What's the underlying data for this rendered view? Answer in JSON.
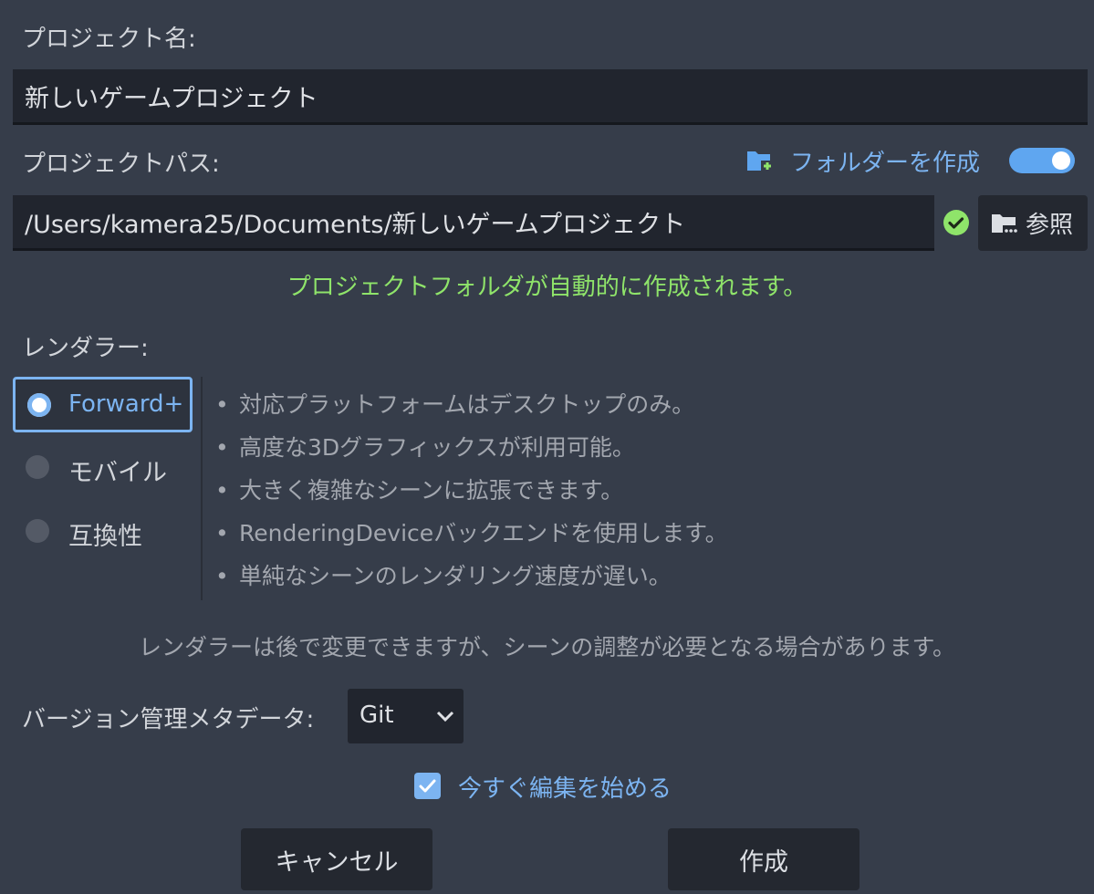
{
  "project_name": {
    "label": "プロジェクト名:",
    "value": "新しいゲームプロジェクト"
  },
  "project_path": {
    "label": "プロジェクトパス:",
    "create_folder_label": "フォルダーを作成",
    "create_folder_enabled": true,
    "value": "/Users/kamera25/Documents/新しいゲームプロジェクト",
    "browse_label": "参照",
    "status_message": "プロジェクトフォルダが自動的に作成されます。"
  },
  "renderer": {
    "label": "レンダラー:",
    "options": [
      {
        "label": "Forward+",
        "selected": true
      },
      {
        "label": "モバイル",
        "selected": false
      },
      {
        "label": "互換性",
        "selected": false
      }
    ],
    "bullet_glyph": "•",
    "description": [
      "対応プラットフォームはデスクトップのみ。",
      "高度な3Dグラフィックスが利用可能。",
      "大きく複雑なシーンに拡張できます。",
      "RenderingDeviceバックエンドを使用します。",
      "単純なシーンのレンダリング速度が遅い。"
    ],
    "note": "レンダラーは後で変更できますが、シーンの調整が必要となる場合があります。"
  },
  "vcs": {
    "label": "バージョン管理メタデータ:",
    "selected": "Git"
  },
  "edit_now": {
    "label": "今すぐ編集を始める",
    "checked": true
  },
  "buttons": {
    "cancel": "キャンセル",
    "create": "作成"
  },
  "colors": {
    "background": "#363d4a",
    "accent": "#7cb4f1",
    "success": "#8fe46a"
  },
  "icons": {
    "folder_add": "folder-add-icon",
    "status_ok": "check-circle-icon",
    "folder_browse": "folder-browse-icon",
    "dropdown": "chevron-down-icon",
    "checkbox": "checkbox-checked-icon"
  }
}
